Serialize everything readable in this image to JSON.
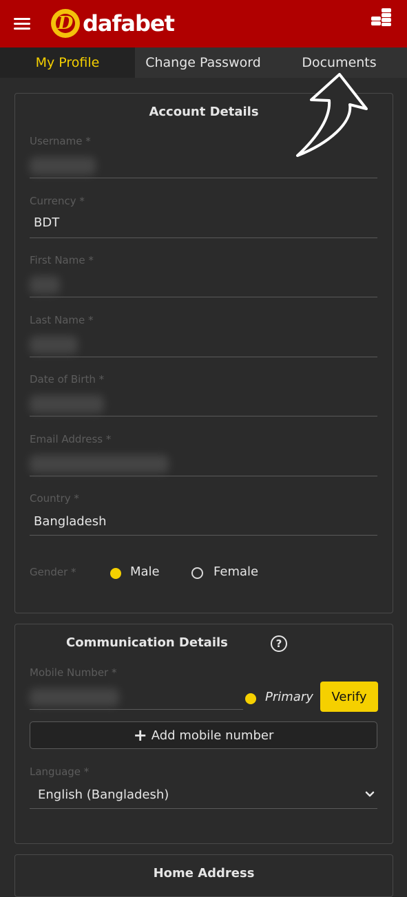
{
  "header": {
    "logo_text": "dafabet",
    "logo_mark": "D",
    "menu_icon": "hamburger-menu-icon",
    "coins_icon": "coins-icon",
    "brand_color": "#b00000",
    "accent_color": "#f5d000"
  },
  "tabs": [
    {
      "label": "My Profile",
      "active": true
    },
    {
      "label": "Change Password",
      "active": false
    },
    {
      "label": "Documents",
      "active": false
    }
  ],
  "account_details": {
    "title": "Account Details",
    "fields": [
      {
        "label": "Username *",
        "value": ""
      },
      {
        "label": "Currency *",
        "value": "BDT"
      },
      {
        "label": "First Name *",
        "value": ""
      },
      {
        "label": "Last Name *",
        "value": ""
      },
      {
        "label": "Date of Birth *",
        "value": ""
      },
      {
        "label": "Email Address *",
        "value": ""
      },
      {
        "label": "Country *",
        "value": "Bangladesh"
      }
    ],
    "gender": {
      "label": "Gender *",
      "options": [
        "Male",
        "Female"
      ],
      "selected": "Male"
    }
  },
  "communication_details": {
    "title": "Communication Details",
    "help_icon": "question-circle-icon",
    "mobile_label": "Mobile Number *",
    "primary_label": "Primary",
    "verify_label": "Verify",
    "add_mobile_label": "Add mobile number",
    "language_label": "Language *",
    "language_value": "English (Bangladesh)"
  },
  "home_address": {
    "title": "Home Address"
  }
}
